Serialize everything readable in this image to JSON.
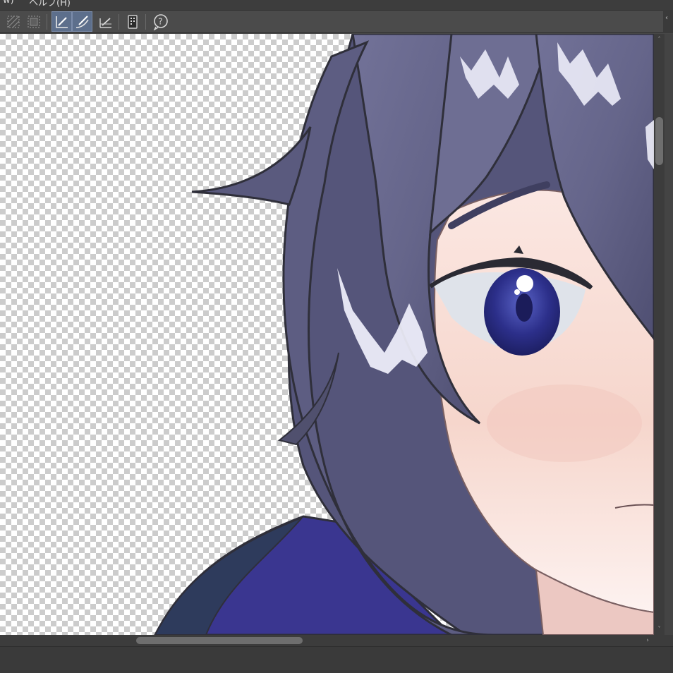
{
  "menubar": {
    "items": [
      {
        "label": "w)"
      },
      {
        "label": "ヘルプ(H)"
      }
    ]
  },
  "toolbar": {
    "buttons": [
      {
        "icon": "clear-selection-icon",
        "active": false
      },
      {
        "icon": "selection-border-icon",
        "active": false
      },
      {
        "icon": "ruler-snap-icon",
        "active": true
      },
      {
        "icon": "curve-ruler-snap-icon",
        "active": true
      },
      {
        "icon": "grid-snap-icon",
        "active": false
      },
      {
        "icon": "device-panel-icon",
        "active": false
      },
      {
        "icon": "help-icon",
        "active": false
      }
    ]
  },
  "side_tab": {
    "icon": "collapse-arrow-icon",
    "glyph": "‹"
  },
  "canvas": {
    "background": "transparency-checkerboard",
    "colors": {
      "hair": "#6a6a8e",
      "hair_shadow": "#50506e",
      "outline": "#2f2f3a",
      "skin": "#fbe9e4",
      "blush": "#f2c9c0",
      "iris": "#2c2f8a",
      "jacket": "#3a3690",
      "jacket_collar": "#2e3b5c"
    }
  },
  "scrollbars": {
    "vertical": {
      "up": "˄",
      "down": "˅"
    },
    "horizontal": {
      "right": "›"
    }
  }
}
